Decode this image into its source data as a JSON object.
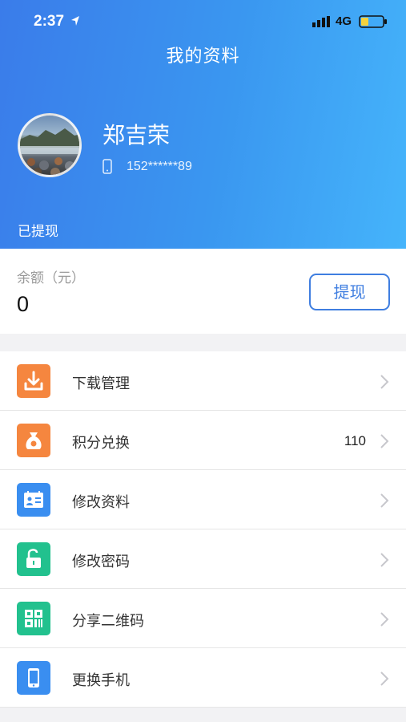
{
  "status_bar": {
    "time": "2:37",
    "network": "4G"
  },
  "header": {
    "title": "我的资料",
    "user_name": "郑吉荣",
    "phone": "152******89",
    "withdrawn_label": "已提现"
  },
  "balance": {
    "label": "余额（元）",
    "value": "0",
    "withdraw_button": "提现"
  },
  "menu": {
    "items": [
      {
        "label": "下载管理",
        "icon": "download-icon",
        "color": "#f5863f",
        "value": ""
      },
      {
        "label": "积分兑换",
        "icon": "money-bag-icon",
        "color": "#f5863f",
        "value": "110"
      },
      {
        "label": "修改资料",
        "icon": "id-card-icon",
        "color": "#3a8ef0",
        "value": ""
      },
      {
        "label": "修改密码",
        "icon": "unlock-icon",
        "color": "#22c18e",
        "value": ""
      },
      {
        "label": "分享二维码",
        "icon": "qr-code-icon",
        "color": "#22c18e",
        "value": ""
      },
      {
        "label": "更换手机",
        "icon": "phone-icon",
        "color": "#3a8ef0",
        "value": ""
      }
    ]
  },
  "colors": {
    "header_gradient_start": "#3a7cea",
    "header_gradient_end": "#45b4fb",
    "accent_blue": "#3f7ee0",
    "orange": "#f5863f",
    "green": "#22c18e"
  }
}
